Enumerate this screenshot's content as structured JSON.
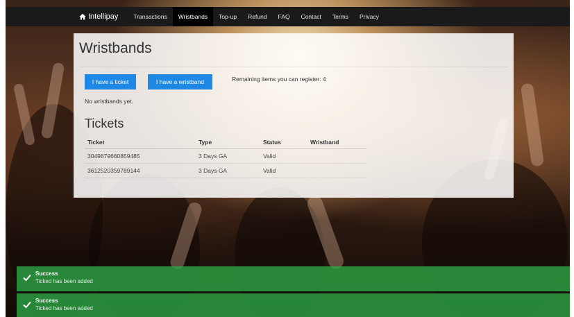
{
  "navbar": {
    "brand": "Intellipay",
    "links": [
      {
        "label": "Transactions"
      },
      {
        "label": "Wristbands",
        "active": true
      },
      {
        "label": "Top-up"
      },
      {
        "label": "Refund"
      },
      {
        "label": "FAQ"
      },
      {
        "label": "Contact"
      },
      {
        "label": "Terms"
      },
      {
        "label": "Privacy"
      }
    ]
  },
  "page": {
    "title": "Wristbands",
    "btn_ticket": "I have a ticket",
    "btn_wristband": "I have a wristband",
    "remaining": "Remaining items you can register: 4",
    "no_wristbands": "No wristbands yet."
  },
  "tickets": {
    "heading": "Tickets",
    "columns": [
      "Ticket",
      "Type",
      "Status",
      "Wristband"
    ],
    "rows": [
      [
        "3049879660859485",
        "3 Days GA",
        "Valid",
        ""
      ],
      [
        "3612520359789144",
        "3 Days GA",
        "Valid",
        ""
      ]
    ]
  },
  "toasts": [
    {
      "title": "Success",
      "message": "Ticked has been added"
    },
    {
      "title": "Success",
      "message": "Ticked has been added"
    }
  ],
  "colors": {
    "primary": "#1e88e5",
    "success": "#2eaa46",
    "navbar": "#1a1a1a"
  },
  "icons": {
    "brand": "home-icon",
    "toast": "check-icon"
  }
}
